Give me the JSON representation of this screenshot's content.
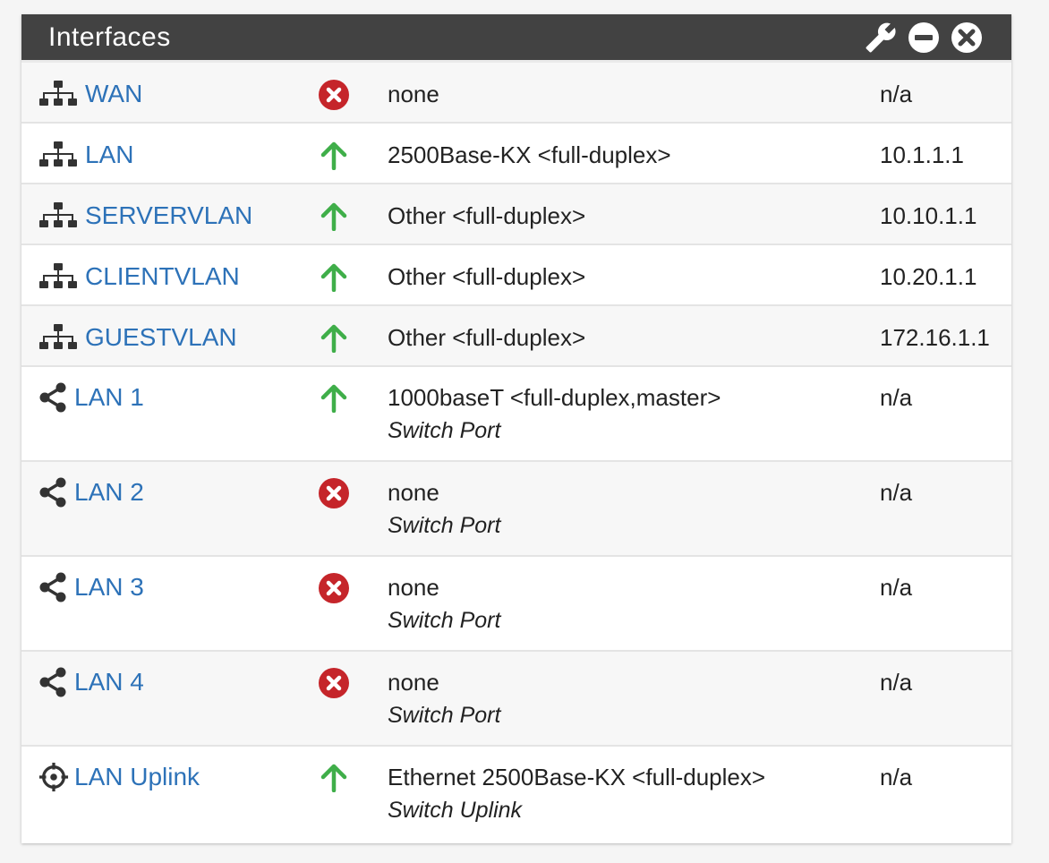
{
  "panel": {
    "title": "Interfaces",
    "actions": [
      {
        "name": "wrench-icon"
      },
      {
        "name": "minus-circle-icon"
      },
      {
        "name": "close-circle-icon"
      }
    ]
  },
  "colors": {
    "header_bg": "#424242",
    "link": "#2d72b8",
    "status_up": "#3fae49",
    "status_down": "#c5252a"
  },
  "interfaces": [
    {
      "name": "WAN",
      "icon": "sitemap-icon",
      "status": "down",
      "media": "none",
      "sub": "",
      "address": "n/a"
    },
    {
      "name": "LAN",
      "icon": "sitemap-icon",
      "status": "up",
      "media": "2500Base-KX <full-duplex>",
      "sub": "",
      "address": "10.1.1.1"
    },
    {
      "name": "SERVERVLAN",
      "icon": "sitemap-icon",
      "status": "up",
      "media": "Other <full-duplex>",
      "sub": "",
      "address": "10.10.1.1"
    },
    {
      "name": "CLIENTVLAN",
      "icon": "sitemap-icon",
      "status": "up",
      "media": "Other <full-duplex>",
      "sub": "",
      "address": "10.20.1.1"
    },
    {
      "name": "GUESTVLAN",
      "icon": "sitemap-icon",
      "status": "up",
      "media": "Other <full-duplex>",
      "sub": "",
      "address": "172.16.1.1"
    },
    {
      "name": "LAN 1",
      "icon": "share-icon",
      "status": "up",
      "media": "1000baseT <full-duplex,master>",
      "sub": "Switch Port",
      "address": "n/a"
    },
    {
      "name": "LAN 2",
      "icon": "share-icon",
      "status": "down",
      "media": "none",
      "sub": "Switch Port",
      "address": "n/a"
    },
    {
      "name": "LAN 3",
      "icon": "share-icon",
      "status": "down",
      "media": "none",
      "sub": "Switch Port",
      "address": "n/a"
    },
    {
      "name": "LAN 4",
      "icon": "share-icon",
      "status": "down",
      "media": "none",
      "sub": "Switch Port",
      "address": "n/a"
    },
    {
      "name": "LAN Uplink",
      "icon": "crosshairs-icon",
      "status": "up",
      "media": "Ethernet 2500Base-KX <full-duplex>",
      "sub": "Switch Uplink",
      "address": "n/a"
    }
  ]
}
